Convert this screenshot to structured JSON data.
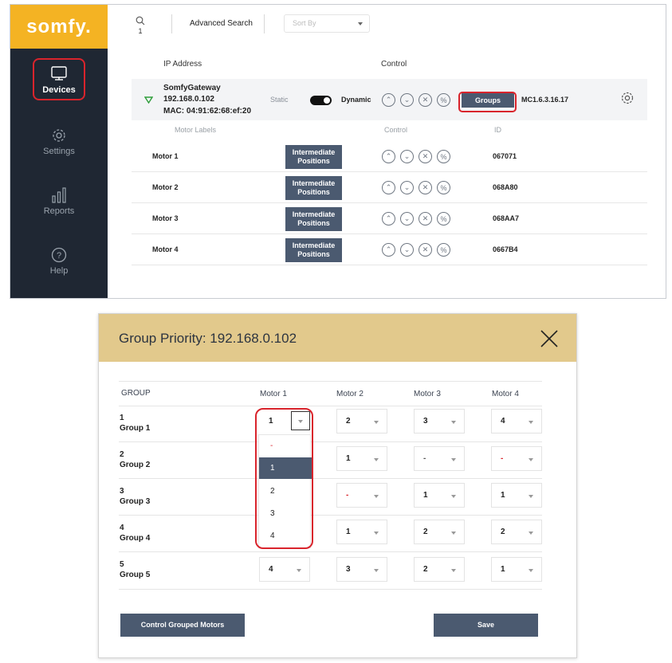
{
  "app": {
    "logo": "somfy.",
    "nav": [
      {
        "label": "Devices",
        "icon": "devices-icon"
      },
      {
        "label": "Settings",
        "icon": "gear-icon"
      },
      {
        "label": "Reports",
        "icon": "bar-chart-icon"
      },
      {
        "label": "Help",
        "icon": "help-icon"
      }
    ],
    "search_count": "1",
    "advanced_search": "Advanced Search",
    "sort_placeholder": "Sort By",
    "col_ip": "IP Address",
    "col_control": "Control",
    "gateway": {
      "name": "SomfyGateway",
      "ip": "192.168.0.102",
      "mac": "MAC: 04:91:62:68:ef:20",
      "static_label": "Static",
      "dynamic_label": "Dynamic",
      "groups_label": "Groups",
      "firmware": "MC1.6.3.16.17"
    },
    "sub_headers": {
      "labels": "Motor Labels",
      "control": "Control",
      "id": "ID"
    },
    "intermediate_label_1": "Intermediate",
    "intermediate_label_2": "Positions",
    "motors": [
      {
        "name": "Motor 1",
        "id": "067071"
      },
      {
        "name": "Motor 2",
        "id": "068A80"
      },
      {
        "name": "Motor 3",
        "id": "068AA7"
      },
      {
        "name": "Motor 4",
        "id": "0667B4"
      }
    ]
  },
  "modal": {
    "title": "Group Priority:  192.168.0.102",
    "group_header": "GROUP",
    "motor_headers": [
      "Motor 1",
      "Motor 2",
      "Motor 3",
      "Motor 4"
    ],
    "groups": [
      {
        "num": "1",
        "name": "Group 1",
        "values": [
          "1",
          "2",
          "3",
          "4"
        ]
      },
      {
        "num": "2",
        "name": "Group 2",
        "values": [
          "",
          "1",
          "-",
          "-"
        ]
      },
      {
        "num": "3",
        "name": "Group 3",
        "values": [
          "",
          "-",
          "1",
          "1"
        ]
      },
      {
        "num": "4",
        "name": "Group 4",
        "values": [
          "",
          "1",
          "2",
          "2"
        ]
      },
      {
        "num": "5",
        "name": "Group 5",
        "values": [
          "4",
          "3",
          "2",
          "1"
        ]
      }
    ],
    "dropdown_options": [
      "-",
      "1",
      "2",
      "3",
      "4"
    ],
    "dropdown_selected": "1",
    "control_grouped_label": "Control Grouped Motors",
    "save_label": "Save"
  },
  "colors": {
    "accent": "#f4b323",
    "sidebar": "#1f2733",
    "button": "#4b5a70",
    "highlight": "#d9242c",
    "modal_header": "#e2c98c"
  }
}
